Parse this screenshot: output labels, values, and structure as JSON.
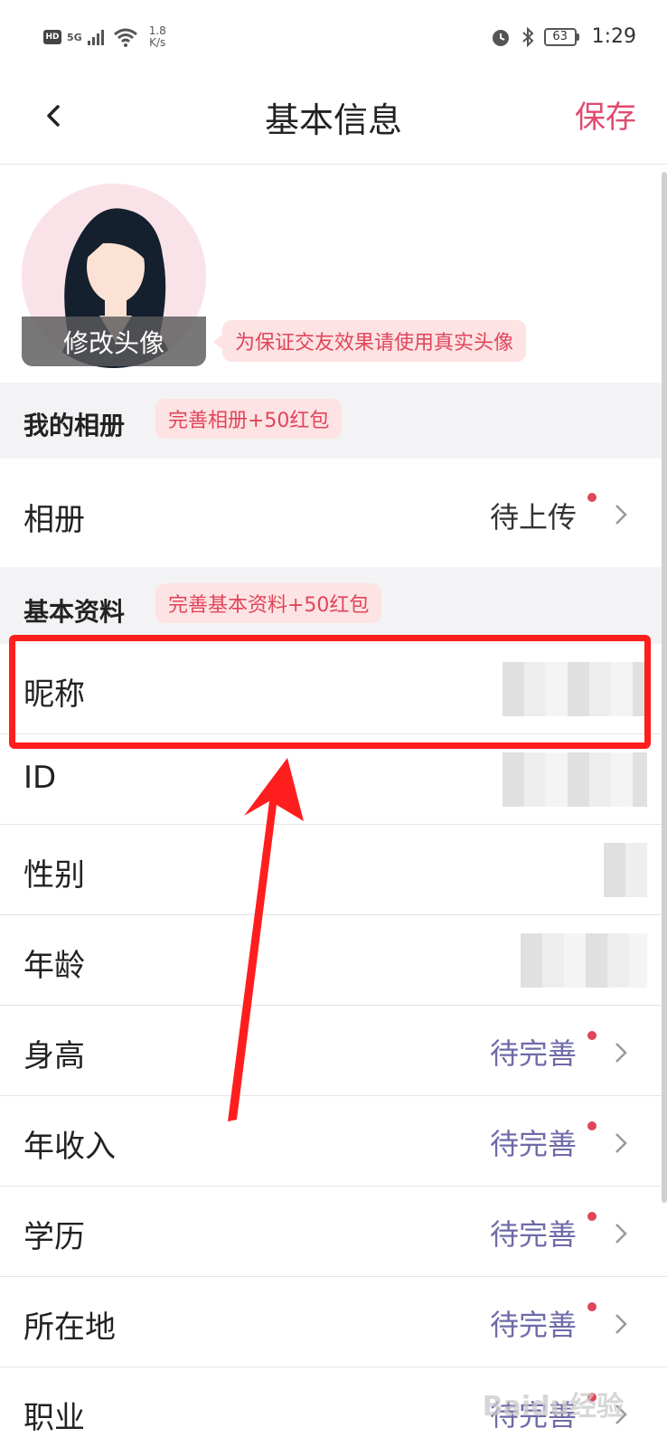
{
  "status_bar": {
    "hd": "HD",
    "network": "5G",
    "speed_top": "1.8",
    "speed_unit": "K/s",
    "battery": "63",
    "time": "1:29"
  },
  "header": {
    "title": "基本信息",
    "save_label": "保存"
  },
  "avatar": {
    "edit_label": "修改头像",
    "tip": "为保证交友效果请使用真实头像"
  },
  "album_section": {
    "title": "我的相册",
    "badge": "完善相册+50红包"
  },
  "album_row": {
    "label": "相册",
    "value": "待上传"
  },
  "basic_section": {
    "title": "基本资料",
    "badge": "完善基本资料+50红包"
  },
  "rows": [
    {
      "label": "昵称"
    },
    {
      "label": "ID"
    },
    {
      "label": "性别"
    },
    {
      "label": "年龄"
    },
    {
      "label": "身高",
      "value": "待完善"
    },
    {
      "label": "年收入",
      "value": "待完善"
    },
    {
      "label": "学历",
      "value": "待完善"
    },
    {
      "label": "所在地",
      "value": "待完善"
    },
    {
      "label": "职业",
      "value": "待完善"
    }
  ],
  "watermark": "Baidu经验",
  "colors": {
    "accent": "#e04b6e",
    "pending": "#6f6aa8",
    "highlight": "#ff1e1e"
  }
}
